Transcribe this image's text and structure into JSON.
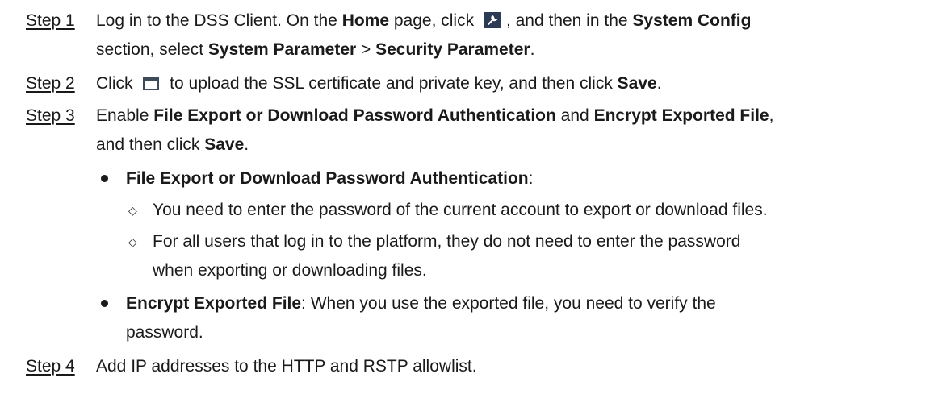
{
  "steps": [
    {
      "label": "Step 1",
      "parts": {
        "a": "Log in to the DSS Client. On the ",
        "b": "Home",
        "c": " page, click ",
        "d": ", and then in the ",
        "e": "System Config",
        "f": " section, select ",
        "g": "System Parameter",
        "h": " > ",
        "i": "Security Parameter",
        "j": "."
      },
      "icon": "tools-icon"
    },
    {
      "label": "Step 2",
      "parts": {
        "a": "Click ",
        "b": " to upload the SSL certificate and private key, and then click ",
        "c": "Save",
        "d": "."
      },
      "icon": "folder-icon"
    },
    {
      "label": "Step 3",
      "parts": {
        "a": "Enable ",
        "b": "File Export or Download Password Authentication",
        "c": " and ",
        "d": "Encrypt Exported File",
        "e": ",",
        "f": "and then click ",
        "g": "Save",
        "h": "."
      }
    },
    {
      "label": "Step 4",
      "text": "Add IP addresses to the HTTP and RSTP allowlist."
    }
  ],
  "bullets": [
    {
      "title": "File Export or Download Password Authentication",
      "suffix": ":",
      "subitems": [
        {
          "marker": "◇",
          "text": "You need to enter the password of the current account to export or download files."
        },
        {
          "marker": "◇",
          "text": "For all users that log in to the platform, they do not need to enter the password",
          "text2": "when exporting or downloading files."
        }
      ]
    },
    {
      "title": "Encrypt Exported File",
      "suffix": ": When you use the exported file, you need to verify the",
      "suffix2": "password."
    }
  ]
}
